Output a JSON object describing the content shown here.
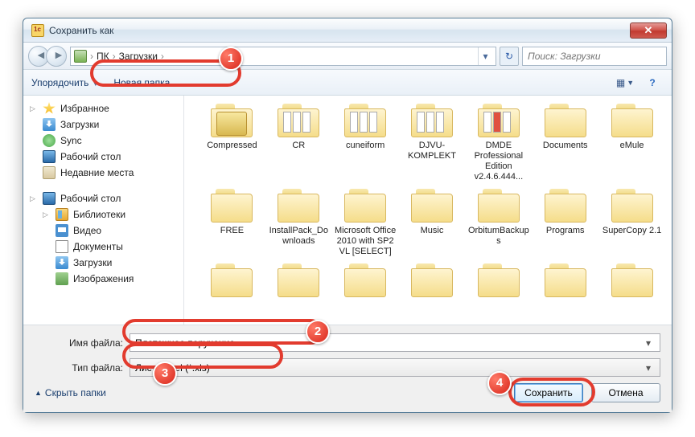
{
  "window": {
    "title": "Сохранить как",
    "close_symbol": "✕"
  },
  "nav": {
    "back_symbol": "◄",
    "forward_symbol": "►",
    "refresh_symbol": "↻",
    "breadcrumb": {
      "root": "ПК",
      "folder": "Загрузки",
      "sep": "›"
    },
    "dropdown_symbol": "▾",
    "search_placeholder": "Поиск: Загрузки"
  },
  "toolbar": {
    "organize": "Упорядочить",
    "new_folder": "Новая папка"
  },
  "sidebar": {
    "favorites": "Избранное",
    "downloads": "Загрузки",
    "sync": "Sync",
    "desktop": "Рабочий стол",
    "recent": "Недавние места",
    "desktop2": "Рабочий стол",
    "libraries": "Библиотеки",
    "videos": "Видео",
    "documents": "Документы",
    "downloads2": "Загрузки",
    "images": "Изображения"
  },
  "files": [
    {
      "name": "Compressed",
      "type": "arc"
    },
    {
      "name": "CR",
      "type": "pages"
    },
    {
      "name": "cuneiform",
      "type": "pages"
    },
    {
      "name": "DJVU-KOMPLEKT",
      "type": "pages"
    },
    {
      "name": "DMDE Professional Edition v2.4.6.444...",
      "type": "red"
    },
    {
      "name": "Documents",
      "type": "plain"
    },
    {
      "name": "eMule",
      "type": "plain"
    },
    {
      "name": "FREE",
      "type": "plain"
    },
    {
      "name": "InstallPack_Downloads",
      "type": "plain"
    },
    {
      "name": "Microsoft Office 2010 with SP2 VL [SELECT]",
      "type": "plain"
    },
    {
      "name": "Music",
      "type": "plain"
    },
    {
      "name": "OrbitumBackups",
      "type": "plain"
    },
    {
      "name": "Programs",
      "type": "plain"
    },
    {
      "name": "SuperCopy 2.1",
      "type": "plain"
    },
    {
      "name": "",
      "type": "plain"
    },
    {
      "name": "",
      "type": "plain"
    },
    {
      "name": "",
      "type": "plain"
    },
    {
      "name": "",
      "type": "plain"
    },
    {
      "name": "",
      "type": "plain"
    },
    {
      "name": "",
      "type": "plain"
    },
    {
      "name": "",
      "type": "plain"
    }
  ],
  "bottom": {
    "filename_label": "Имя файла:",
    "filename_value": "Платежное поручение",
    "filetype_label": "Тип файла:",
    "filetype_value": "Лист Excel (*.xls)",
    "hide_folders": "Скрыть папки",
    "save": "Сохранить",
    "cancel": "Отмена"
  },
  "annotations": {
    "b1": "1",
    "b2": "2",
    "b3": "3",
    "b4": "4"
  }
}
